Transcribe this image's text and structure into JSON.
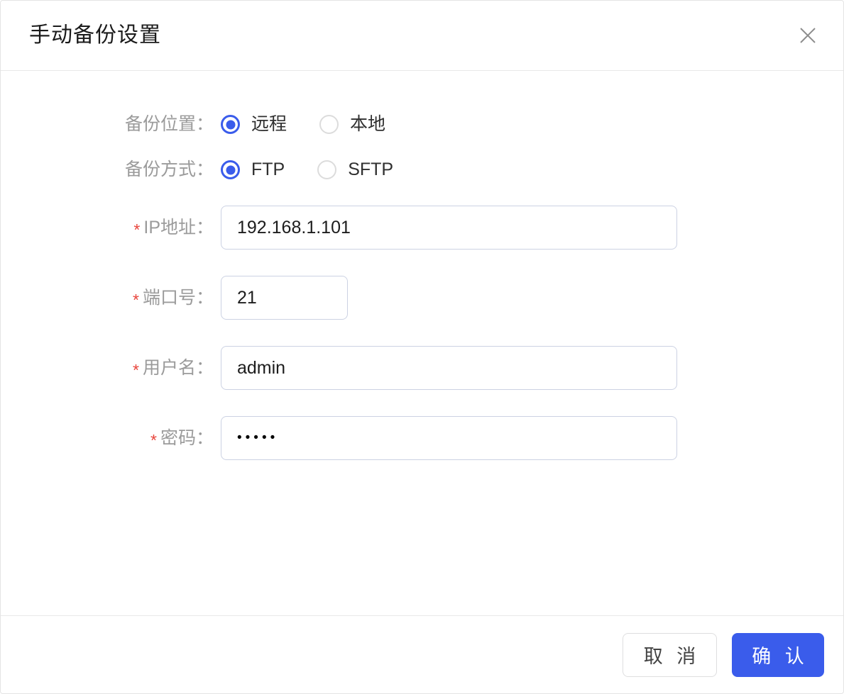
{
  "dialog": {
    "title": "手动备份设置",
    "close_icon": "close-icon",
    "accent_color": "#3a5ceb",
    "label_color": "#9b9b9b",
    "required_color": "#e8453c",
    "border_color": "#ccd2e3"
  },
  "form": {
    "location": {
      "label": "备份位置：",
      "required": false,
      "options": [
        {
          "label": "远程",
          "selected": true
        },
        {
          "label": "本地",
          "selected": false
        }
      ]
    },
    "method": {
      "label": "备份方式：",
      "required": false,
      "options": [
        {
          "label": "FTP",
          "selected": true
        },
        {
          "label": "SFTP",
          "selected": false
        }
      ]
    },
    "ip": {
      "required_mark": "*",
      "label": "IP地址：",
      "value": "192.168.1.101",
      "placeholder": ""
    },
    "port": {
      "required_mark": "*",
      "label": "端口号：",
      "value": "21",
      "placeholder": ""
    },
    "username": {
      "required_mark": "*",
      "label": "用户名：",
      "value": "admin",
      "placeholder": ""
    },
    "password": {
      "required_mark": "*",
      "label": "密码：",
      "value": "•••••",
      "placeholder": ""
    }
  },
  "footer": {
    "cancel_label": "取 消",
    "confirm_label": "确 认"
  }
}
